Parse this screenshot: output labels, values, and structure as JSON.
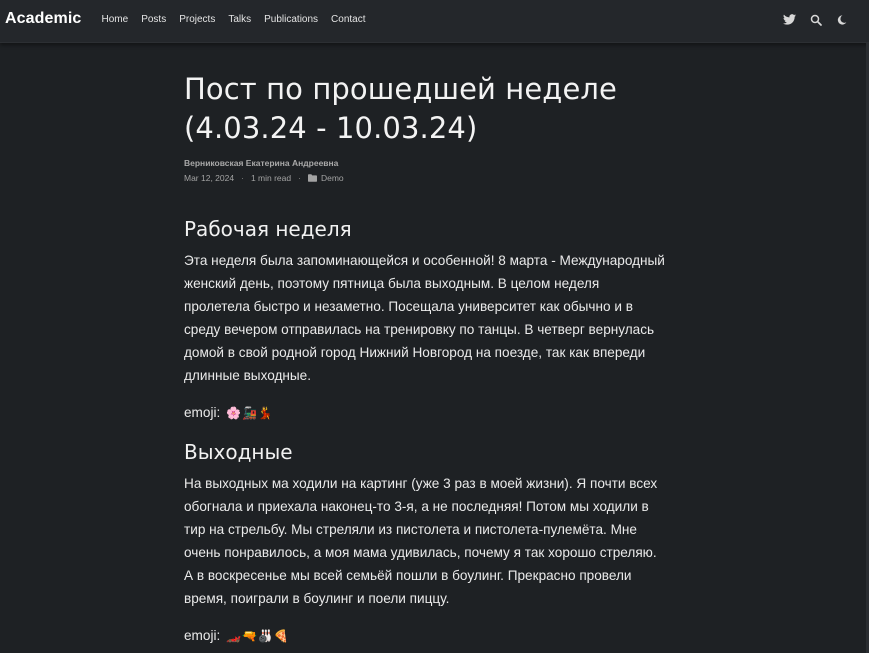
{
  "navbar": {
    "brand": "Academic",
    "links": [
      "Home",
      "Posts",
      "Projects",
      "Talks",
      "Publications",
      "Contact"
    ],
    "icons": [
      "twitter-icon",
      "search-icon",
      "moon-icon"
    ]
  },
  "article": {
    "title": "Пост по прошедшей неделе (4.03.24 - 10.03.24)",
    "author": "Верниковская Екатерина Андреевна",
    "date": "Mar 12, 2024",
    "read_time": "1 min read",
    "category": "Demo",
    "sections": [
      {
        "heading": "Рабочая неделя",
        "paragraph": "Эта неделя была запоминающейся и особенной! 8 марта - Международный женский день, поэтому пятница была выходным. В целом неделя пролетела быстро и незаметно. Посещала университет как обычно и в среду вечером отправилась на тренировку по танцы. В четверг вернулась домой в свой родной город Нижний Новгород на поезде, так как впереди длинные выходные.",
        "emoji_label": "emoji:",
        "emoji": "🌸🚂💃"
      },
      {
        "heading": "Выходные",
        "paragraph": "На выходных ма ходили на картинг (уже 3 раз в моей жизни). Я почти всех обогнала и приехала наконец-то 3-я, а не последняя! Потом мы ходили в тир на стрельбу. Мы стреляли из пистолета и пистолета-пулемёта. Мне очень понравилось, а моя мама удивилась, почему я так хорошо стреляю. А в воскресенье мы всей семьёй пошли в боулинг. Прекрасно провели время, поиграли в боулинг и поели пиццу.",
        "emoji_label": "emoji:",
        "emoji": "🏎️🔫🎳🍕"
      }
    ]
  },
  "colors": {
    "background": "#1e2124",
    "navbar": "#24272b",
    "text": "#eaeaea",
    "muted": "#a3a3a3"
  }
}
